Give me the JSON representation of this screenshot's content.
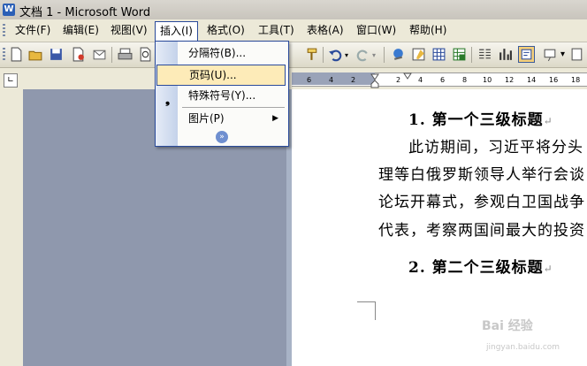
{
  "window": {
    "title": "文档 1 - Microsoft Word",
    "app_icon": "word-icon"
  },
  "menubar": {
    "items": [
      {
        "label": "文件(F)"
      },
      {
        "label": "编辑(E)"
      },
      {
        "label": "视图(V)"
      },
      {
        "label": "插入(I)",
        "open": true
      },
      {
        "label": "格式(O)"
      },
      {
        "label": "工具(T)"
      },
      {
        "label": "表格(A)"
      },
      {
        "label": "窗口(W)"
      },
      {
        "label": "帮助(H)"
      }
    ]
  },
  "insert_menu": {
    "items": [
      {
        "label": "分隔符(B)..."
      },
      {
        "label": "页码(U)...",
        "highlighted": true
      },
      {
        "label": "特殊符号(Y)..."
      },
      {
        "label": "图片(P)",
        "has_submenu": true
      }
    ],
    "more_icon": "expand-chevrons-icon"
  },
  "ruler": {
    "numbers": [
      "6",
      "4",
      "2",
      "2",
      "4",
      "6",
      "8",
      "10",
      "12",
      "14",
      "16",
      "18"
    ]
  },
  "document": {
    "lines": [
      {
        "text": "1. 第一个三级标题",
        "heading": true
      },
      {
        "text": "此访期间，习近平将分头",
        "heading": false
      },
      {
        "text": "理等白俄罗斯领导人举行会谈",
        "heading": false
      },
      {
        "text": "论坛开幕式，参观白卫国战争",
        "heading": false
      },
      {
        "text": "代表，考察两国间最大的投资",
        "heading": false
      },
      {
        "text": "2. 第二个三级标题",
        "heading": true
      }
    ],
    "paragraph_mark": "↵"
  },
  "watermark": {
    "text": "Bai 经验",
    "sub": "jingyan.baidu.com"
  },
  "colors": {
    "menu_highlight": "#fdebb8",
    "menu_border": "#2a4a9a",
    "gray_pane": "#8f98ad"
  }
}
